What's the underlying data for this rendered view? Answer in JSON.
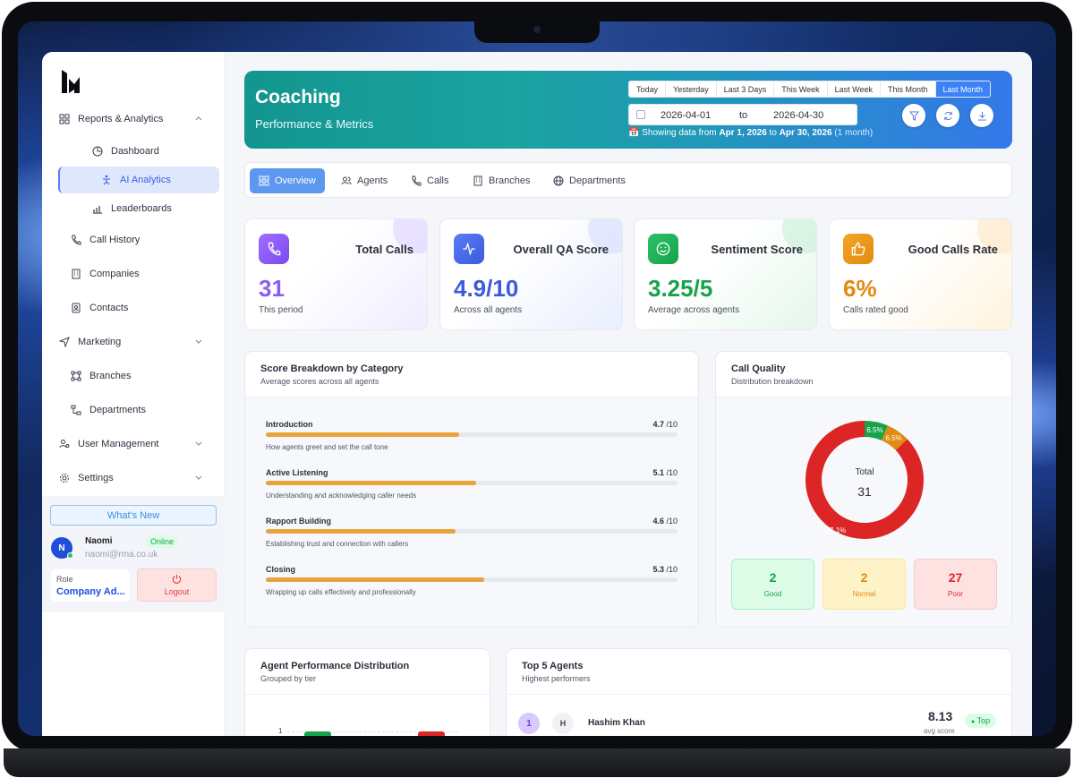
{
  "sidebar": {
    "items": [
      {
        "label": "Reports & Analytics"
      },
      {
        "label": "Dashboard"
      },
      {
        "label": "AI Analytics"
      },
      {
        "label": "Leaderboards"
      },
      {
        "label": "Call History"
      },
      {
        "label": "Companies"
      },
      {
        "label": "Contacts"
      },
      {
        "label": "Marketing"
      },
      {
        "label": "Branches"
      },
      {
        "label": "Departments"
      },
      {
        "label": "User Management"
      },
      {
        "label": "Settings"
      }
    ],
    "whats_new": "What's New",
    "user": {
      "initial": "N",
      "name": "Naomi",
      "email": "naomi@rma.co.uk",
      "status": "Online",
      "role_label": "Role",
      "role_value": "Company Ad...",
      "logout": "Logout"
    }
  },
  "hero": {
    "title": "Coaching",
    "subtitle": "Performance & Metrics",
    "ranges": [
      "Today",
      "Yesterday",
      "Last 3 Days",
      "This Week",
      "Last Week",
      "This Month",
      "Last Month"
    ],
    "active_range": "Last Month",
    "date_from": "2026-04-01",
    "date_sep": "to",
    "date_to": "2026-04-30",
    "info_prefix": "📅 Showing data from ",
    "info_from": "Apr 1, 2026",
    "info_mid": " to ",
    "info_to": "Apr 30, 2026",
    "info_suffix": "(1 month)"
  },
  "tabs": [
    "Overview",
    "Agents",
    "Calls",
    "Branches",
    "Departments"
  ],
  "stats": [
    {
      "title": "Total Calls",
      "value": "31",
      "sub": "This period",
      "color": "#8b5cf6"
    },
    {
      "title": "Overall QA Score",
      "value": "4.9/10",
      "sub": "Across all agents",
      "color": "#3b5bdb"
    },
    {
      "title": "Sentiment Score",
      "value": "3.25/5",
      "sub": "Average across agents",
      "color": "#16a34a"
    },
    {
      "title": "Good Calls Rate",
      "value": "6%",
      "sub": "Calls rated good",
      "color": "#e08a12"
    }
  ],
  "score_breakdown": {
    "title": "Score Breakdown by Category",
    "subtitle": "Average scores across all agents",
    "unit": "/10",
    "categories": [
      {
        "name": "Introduction",
        "score": 4.7,
        "score_label": "4.7",
        "desc": "How agents greet and set the call tone"
      },
      {
        "name": "Active Listening",
        "score": 5.1,
        "score_label": "5.1",
        "desc": "Understanding and acknowledging caller needs"
      },
      {
        "name": "Rapport Building",
        "score": 4.6,
        "score_label": "4.6",
        "desc": "Establishing trust and connection with callers"
      },
      {
        "name": "Closing",
        "score": 5.3,
        "score_label": "5.3",
        "desc": "Wrapping up calls effectively and professionally"
      }
    ]
  },
  "call_quality": {
    "title": "Call Quality",
    "subtitle": "Distribution breakdown",
    "total_label": "Total",
    "total": "31",
    "slices": [
      {
        "name": "Good",
        "count": 2,
        "pct_label": "6.5%",
        "color": "#16a34a"
      },
      {
        "name": "Normal",
        "count": 2,
        "pct_label": "6.5%",
        "color": "#e08a12"
      },
      {
        "name": "Poor",
        "count": 27,
        "pct_label": "87.1%",
        "color": "#dc2626"
      }
    ],
    "boxes": [
      {
        "count": "2",
        "label": "Good"
      },
      {
        "count": "2",
        "label": "Normal"
      },
      {
        "count": "27",
        "label": "Poor"
      }
    ]
  },
  "agent_dist": {
    "title": "Agent Performance Distribution",
    "subtitle": "Grouped by tier",
    "axis_tick": "1"
  },
  "top_agents": {
    "title": "Top 5 Agents",
    "subtitle": "Highest performers",
    "rows": [
      {
        "rank": "1",
        "initial": "H",
        "name": "Hashim Khan",
        "score": "8.13",
        "score_label": "avg score",
        "badge": "Top"
      }
    ]
  }
}
